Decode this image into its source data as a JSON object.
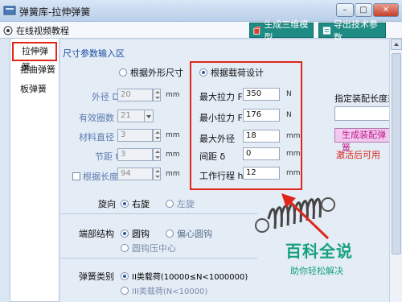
{
  "window": {
    "title": "弹簧库-拉伸弹簧"
  },
  "toolbar": {
    "tutorial_label": "在线视频教程",
    "generate_3d_label": "生成三维模型",
    "export_params_label": "导出技术参数"
  },
  "left_tabs": [
    "拉伸弹簧",
    "扭曲弹簧",
    "板弹簧"
  ],
  "main": {
    "section_title": "尺寸参数输入区",
    "mode_outer": "根据外形尺寸",
    "mode_load": "根据载荷设计",
    "left_fields": [
      {
        "label": "外径 D2",
        "value": "20",
        "unit": "mm"
      },
      {
        "label": "有效圈数 n",
        "value": "21",
        "unit": ""
      },
      {
        "label": "材料直径 d",
        "value": "3",
        "unit": "mm"
      },
      {
        "label": "节距 t",
        "value": "3",
        "unit": "mm"
      },
      {
        "label": "根据长度",
        "value": "94",
        "unit": "mm"
      }
    ],
    "right_fields": [
      {
        "label": "最大拉力 Fn",
        "value": "350",
        "unit": "N"
      },
      {
        "label": "最小拉力 F1",
        "value": "176",
        "unit": "N"
      },
      {
        "label": "最大外径",
        "value": "18",
        "unit": "mm"
      },
      {
        "label": "间距 δ",
        "value": "0",
        "unit": "mm"
      },
      {
        "label": "工作行程 h",
        "value": "12",
        "unit": "mm"
      }
    ],
    "assembly_length_label": "指定装配长度来",
    "generate_assembly_label": "生成装配弹簧",
    "activate_note": "激活后可用",
    "rotation_label": "旋向",
    "rotation_right": "右旋",
    "rotation_left": "左旋",
    "end_structure_label": "端部结构",
    "end_hook": "圆钩",
    "end_offset_hook": "偏心圆钩",
    "end_hook_center": "圆钩压中心",
    "spring_type_label": "弹簧类别",
    "spring_type_2": "II类载荷(10000≤N<1000000)",
    "spring_type_3": "III类载荷(N<10000)"
  },
  "watermark": {
    "title": "百科全说",
    "subtitle": "助你轻松解决"
  },
  "colors": {
    "accent_teal": "#1e8c85",
    "highlight_red": "#e0261b",
    "brand_green": "#17a080"
  }
}
